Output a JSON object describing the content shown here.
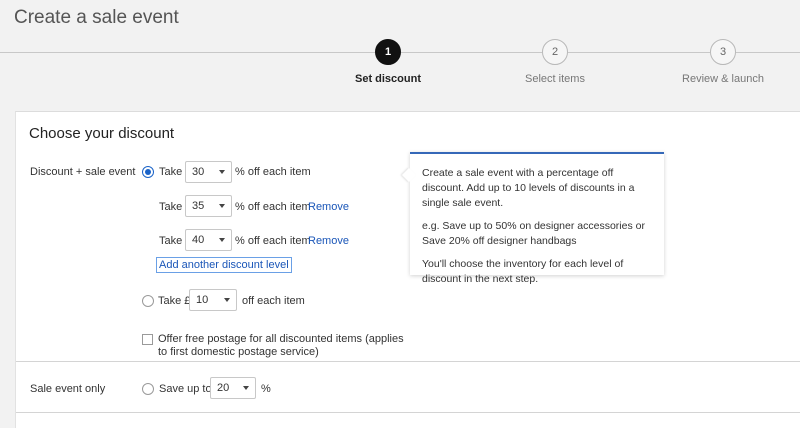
{
  "page": {
    "title": "Create a sale event"
  },
  "stepper": {
    "steps": [
      {
        "number": "1",
        "label": "Set discount",
        "active": true
      },
      {
        "number": "2",
        "label": "Select items",
        "active": false
      },
      {
        "number": "3",
        "label": "Review & launch",
        "active": false
      }
    ]
  },
  "discount": {
    "heading": "Choose your discount",
    "discount_sale": {
      "label": "Discount + sale event",
      "take_word": "Take",
      "suffix": "% off each item",
      "remove_label": "Remove",
      "levels": [
        {
          "value": "30"
        },
        {
          "value": "35"
        },
        {
          "value": "40"
        }
      ],
      "add_link": "Add another discount level"
    },
    "fixed": {
      "take_label": "Take £",
      "value": "10",
      "suffix": "off each item"
    },
    "free_postage": {
      "line1": "Offer free postage for all discounted items (applies",
      "line2": "to first domestic postage service)"
    },
    "sale_only": {
      "label": "Sale event only",
      "prefix": "Save up to",
      "value": "20",
      "suffix": "%"
    },
    "tooltip": {
      "p1": "Create a sale event with a percentage off discount. Add up to 10 levels of discounts in a single sale event.",
      "p2": "e.g. Save up to 50% on designer accessories or Save 20% off designer handbags",
      "p3": "You'll choose the inventory for each level of discount in the next step."
    }
  },
  "colors": {
    "accent": "#1a63c8",
    "link": "#1a56b8",
    "active_step": "#111111"
  }
}
